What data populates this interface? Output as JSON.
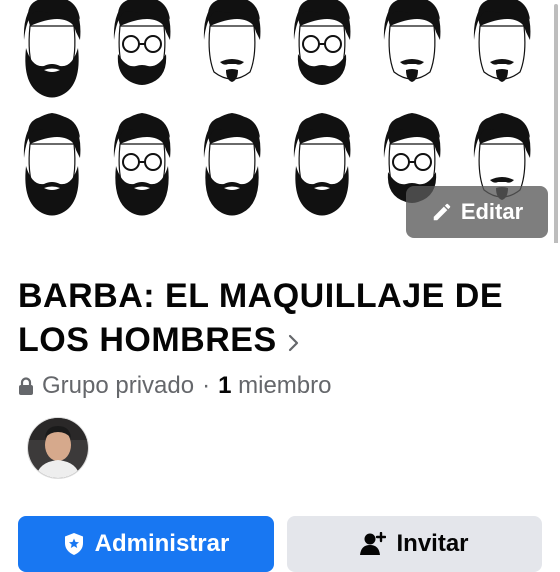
{
  "cover": {
    "edit_label": "Editar"
  },
  "group": {
    "title": "BARBA: EL MAQUILLAJE DE LOS HOMBRES",
    "privacy": "Grupo privado",
    "separator": "·",
    "member_count": "1",
    "member_word": "miembro"
  },
  "actions": {
    "admin_label": "Administrar",
    "invite_label": "Invitar"
  },
  "colors": {
    "primary": "#1877f2",
    "secondary_button": "#e4e6eb",
    "muted_text": "#65676b"
  }
}
